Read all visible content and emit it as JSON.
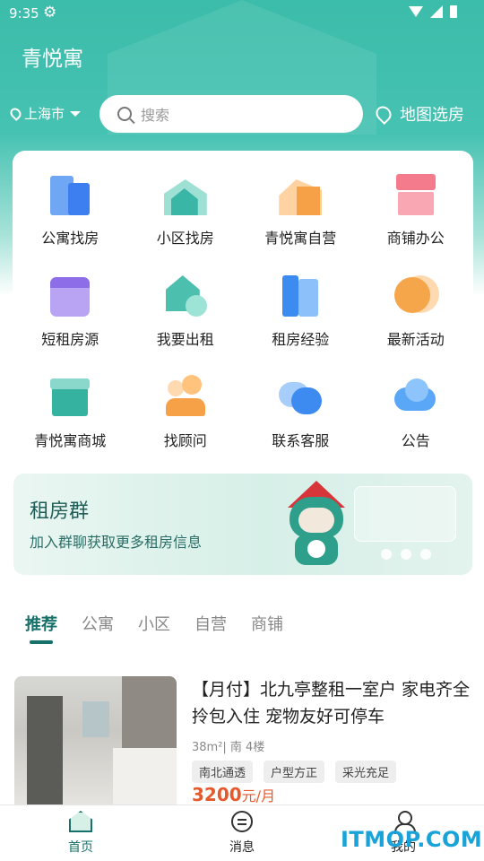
{
  "status_bar": {
    "time": "9:35",
    "icons": [
      "gear-icon",
      "wifi-icon",
      "signal-icon",
      "battery-icon"
    ]
  },
  "header": {
    "title": "青悦寓",
    "city": "上海市",
    "search_placeholder": "搜索",
    "map_select": "地图选房"
  },
  "grid": [
    {
      "label": "公寓找房",
      "icon": "apartment-icon"
    },
    {
      "label": "小区找房",
      "icon": "community-icon"
    },
    {
      "label": "青悦寓自营",
      "icon": "self-operated-icon"
    },
    {
      "label": "商铺办公",
      "icon": "shop-office-icon"
    },
    {
      "label": "短租房源",
      "icon": "calendar-icon"
    },
    {
      "label": "我要出租",
      "icon": "rent-out-icon"
    },
    {
      "label": "租房经验",
      "icon": "book-icon"
    },
    {
      "label": "最新活动",
      "icon": "star-icon"
    },
    {
      "label": "青悦寓商城",
      "icon": "mall-icon"
    },
    {
      "label": "找顾问",
      "icon": "advisor-icon"
    },
    {
      "label": "联系客服",
      "icon": "chat-icon"
    },
    {
      "label": "公告",
      "icon": "notice-icon"
    }
  ],
  "banner": {
    "title": "租房群",
    "subtitle": "加入群聊获取更多租房信息"
  },
  "tabs": [
    {
      "label": "推荐",
      "active": true
    },
    {
      "label": "公寓",
      "active": false
    },
    {
      "label": "小区",
      "active": false
    },
    {
      "label": "自营",
      "active": false
    },
    {
      "label": "商铺",
      "active": false
    }
  ],
  "listing": {
    "title": "【月付】北九亭整租一室户 家电齐全拎包入住 宠物友好可停车",
    "meta": "38m²| 南  4楼",
    "tags": [
      "南北通透",
      "户型方正",
      "采光充足"
    ],
    "price": "3200",
    "price_unit": "元/月"
  },
  "bottom_nav": [
    {
      "label": "首页",
      "icon": "home-icon",
      "active": true
    },
    {
      "label": "消息",
      "icon": "message-icon",
      "active": false
    },
    {
      "label": "我的",
      "icon": "profile-icon",
      "active": false
    }
  ],
  "watermark": "ITMOP.COM",
  "colors": {
    "primary": "#17706a",
    "hero": "#46c2b2",
    "price": "#e55a2c"
  }
}
